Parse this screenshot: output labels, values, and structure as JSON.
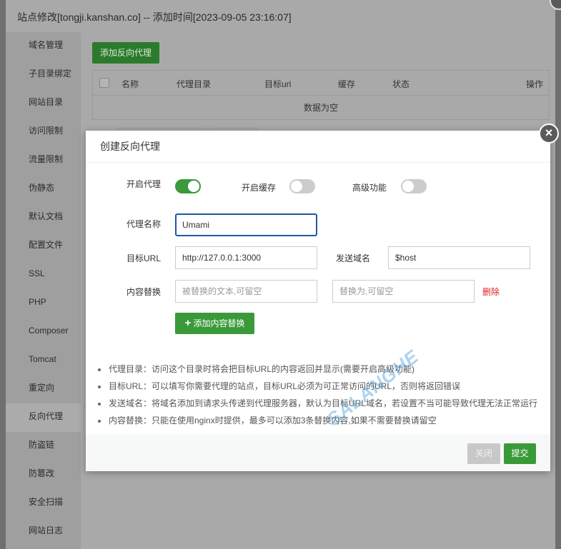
{
  "window": {
    "title": "站点修改[tongji.kanshan.co] -- 添加时间[2023-09-05 23:16:07]"
  },
  "sidebar": {
    "items": [
      "域名管理",
      "子目录绑定",
      "网站目录",
      "访问限制",
      "流量限制",
      "伪静态",
      "默认文档",
      "配置文件",
      "SSL",
      "PHP",
      "Composer",
      "Tomcat",
      "重定向",
      "反向代理",
      "防盗链",
      "防篡改",
      "安全扫描",
      "网站日志"
    ],
    "active": "反向代理"
  },
  "main": {
    "add_button": "添加反向代理",
    "table": {
      "headers": [
        "名称",
        "代理目录",
        "目标url",
        "缓存",
        "状态",
        "操作"
      ],
      "empty": "数据为空"
    }
  },
  "modal": {
    "title": "创建反向代理",
    "toggles": [
      {
        "label": "开启代理",
        "on": true
      },
      {
        "label": "开启缓存",
        "on": false
      },
      {
        "label": "高级功能",
        "on": false
      }
    ],
    "proxy_name": {
      "label": "代理名称",
      "value": "Umami"
    },
    "target_url": {
      "label": "目标URL",
      "value": "http://127.0.0.1:3000"
    },
    "send_domain": {
      "label": "发送域名",
      "value": "$host"
    },
    "replace": {
      "label": "内容替换",
      "from_placeholder": "被替换的文本,可留空",
      "to_placeholder": "替换为,可留空",
      "delete": "删除",
      "add": "添加内容替换"
    },
    "notes": [
      "代理目录：访问这个目录时将会把目标URL的内容返回并显示(需要开启高级功能)",
      "目标URL：可以填写你需要代理的站点，目标URL必须为可正常访问的URL，否则将返回错误",
      "发送域名：将域名添加到请求头传递到代理服务器，默认为目标URL域名，若设置不当可能导致代理无法正常运行",
      "内容替换：只能在使用nginx时提供，最多可以添加3条替换内容,如果不需要替换请留空"
    ],
    "close": "关闭",
    "submit": "提交",
    "watermark": "SALANGHE"
  },
  "colors": {
    "primary": "#3a9a3a",
    "danger": "#e02020",
    "focus": "#1f57a8"
  }
}
